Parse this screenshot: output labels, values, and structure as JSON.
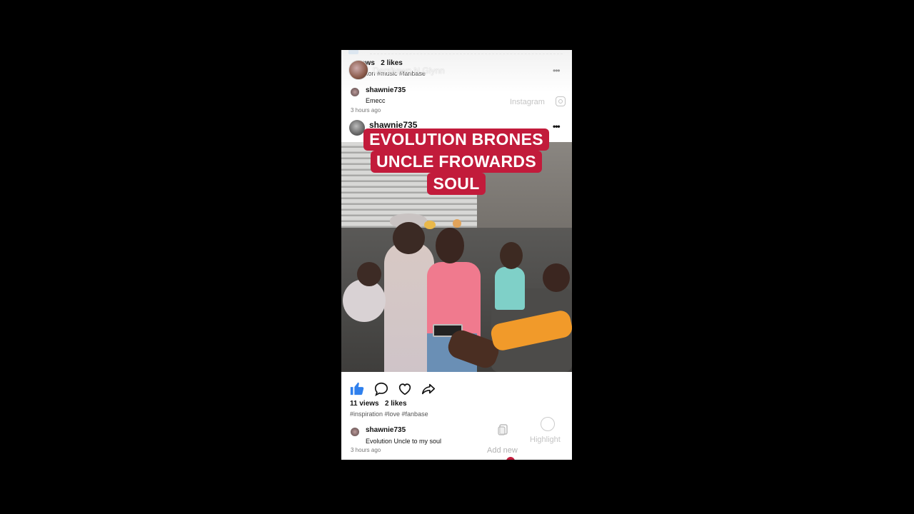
{
  "top_post": {
    "views_text": "ews",
    "likes_text": "2 likes",
    "hashtags": "ation #music #fanbase",
    "comment": {
      "user": "shawnie735",
      "text": "Emecc",
      "time": "3 hours ago"
    }
  },
  "story": {
    "username": "Dershawn N Glynn",
    "source_label": "Instagram",
    "add_new_label": "Add new",
    "highlight_label": "Highlight",
    "more_glyph": "•••"
  },
  "post": {
    "username": "shawnie735",
    "more_glyph": "•••",
    "banner_lines": [
      "EVOLUTION BRONES",
      "UNCLE FROWARDS",
      "SOUL"
    ],
    "views": "11 views",
    "likes": "2 likes",
    "hashtags": "#inspiration #love #fanbase",
    "comment": {
      "user": "shawnie735",
      "text": "Evolution Uncle to my soul",
      "time": "3 hours ago"
    },
    "actions": [
      "thumbs-up-icon",
      "comment-icon",
      "heart-icon",
      "share-icon"
    ]
  },
  "colors": {
    "banner_bg": "#c21b3b",
    "like_blue": "#2f80ed",
    "background": "#000000"
  }
}
